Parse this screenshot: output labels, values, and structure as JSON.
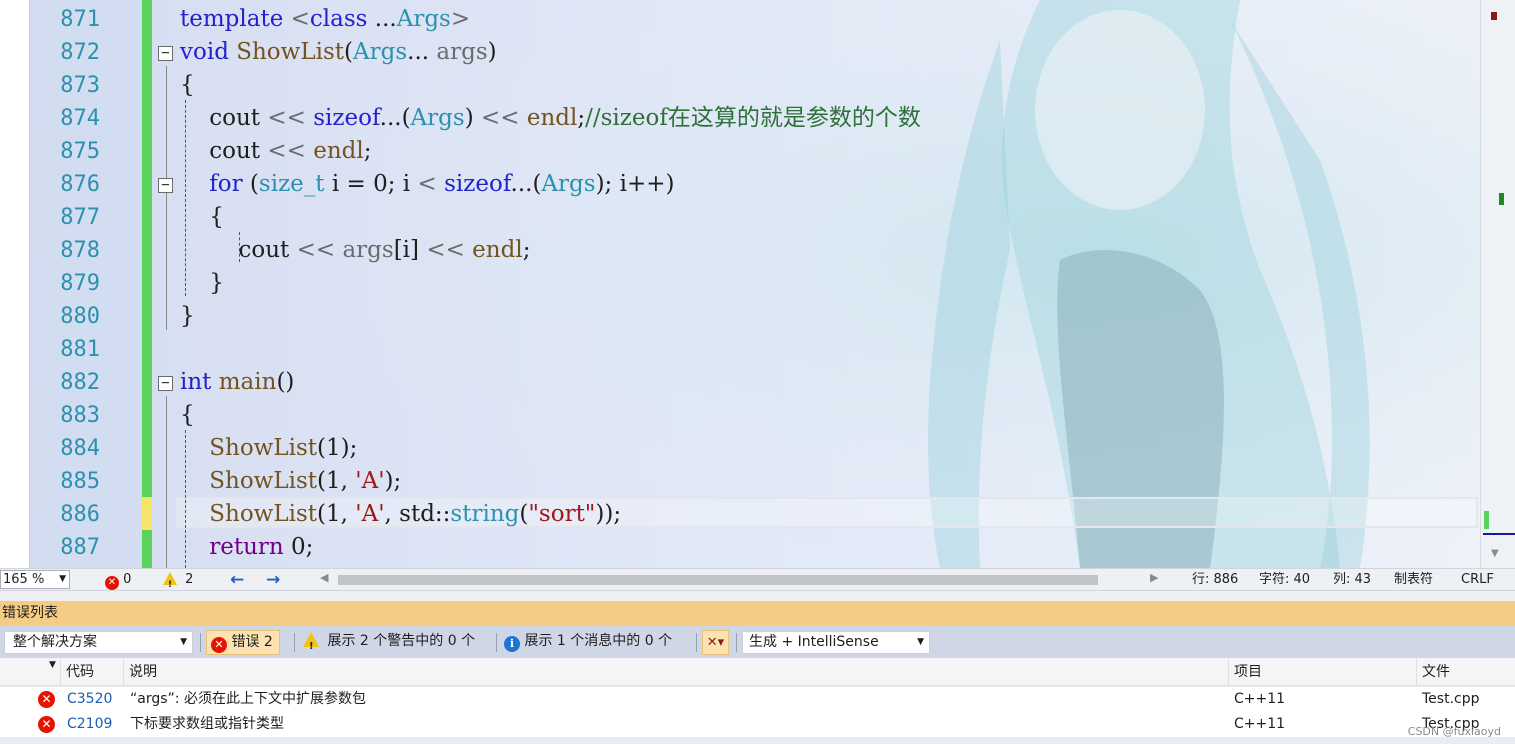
{
  "editor": {
    "lines": [
      {
        "num": "871",
        "fold": "",
        "tokens": [
          [
            "kw",
            "template "
          ],
          [
            "pm",
            "<"
          ],
          [
            "kw",
            "class "
          ],
          [
            "nm",
            "..."
          ],
          [
            "ty",
            "Args"
          ],
          [
            "pm",
            ">"
          ]
        ]
      },
      {
        "num": "872",
        "fold": "−",
        "tokens": [
          [
            "kw",
            "void "
          ],
          [
            "fn",
            "ShowList"
          ],
          [
            "nm",
            "("
          ],
          [
            "ty",
            "Args"
          ],
          [
            "nm",
            "... "
          ],
          [
            "pm",
            "args"
          ],
          [
            "nm",
            ")"
          ]
        ]
      },
      {
        "num": "873",
        "fold": "",
        "tokens": [
          [
            "nm",
            "{"
          ]
        ]
      },
      {
        "num": "874",
        "fold": "",
        "tokens": [
          [
            "nm",
            "    cout "
          ],
          [
            "pm",
            "<< "
          ],
          [
            "kw",
            "sizeof"
          ],
          [
            "nm",
            "...("
          ],
          [
            "ty",
            "Args"
          ],
          [
            "nm",
            ") "
          ],
          [
            "pm",
            "<< "
          ],
          [
            "fn",
            "endl"
          ],
          [
            "nm",
            ";"
          ],
          [
            "cm",
            "//sizeof在这算的就是参数的个数"
          ]
        ]
      },
      {
        "num": "875",
        "fold": "",
        "tokens": [
          [
            "nm",
            "    cout "
          ],
          [
            "pm",
            "<< "
          ],
          [
            "fn",
            "endl"
          ],
          [
            "nm",
            ";"
          ]
        ]
      },
      {
        "num": "876",
        "fold": "−",
        "tokens": [
          [
            "nm",
            "    "
          ],
          [
            "kw",
            "for "
          ],
          [
            "nm",
            "("
          ],
          [
            "ty",
            "size_t "
          ],
          [
            "nm",
            "i = 0; i "
          ],
          [
            "pm",
            "< "
          ],
          [
            "kw",
            "sizeof"
          ],
          [
            "nm",
            "...("
          ],
          [
            "ty",
            "Args"
          ],
          [
            "nm",
            "); i++)"
          ]
        ]
      },
      {
        "num": "877",
        "fold": "",
        "tokens": [
          [
            "nm",
            "    {"
          ]
        ]
      },
      {
        "num": "878",
        "fold": "",
        "tokens": [
          [
            "nm",
            "        cout "
          ],
          [
            "pm",
            "<< "
          ],
          [
            "pm",
            "args"
          ],
          [
            "nm",
            "[i] "
          ],
          [
            "pm",
            "<< "
          ],
          [
            "fn",
            "endl"
          ],
          [
            "nm",
            ";"
          ]
        ]
      },
      {
        "num": "879",
        "fold": "",
        "tokens": [
          [
            "nm",
            "    }"
          ]
        ]
      },
      {
        "num": "880",
        "fold": "",
        "tokens": [
          [
            "nm",
            "}"
          ]
        ]
      },
      {
        "num": "881",
        "fold": "",
        "tokens": []
      },
      {
        "num": "882",
        "fold": "−",
        "tokens": [
          [
            "kw",
            "int "
          ],
          [
            "fn",
            "main"
          ],
          [
            "nm",
            "()"
          ]
        ]
      },
      {
        "num": "883",
        "fold": "",
        "tokens": [
          [
            "nm",
            "{"
          ]
        ]
      },
      {
        "num": "884",
        "fold": "",
        "tokens": [
          [
            "nm",
            "    "
          ],
          [
            "fn",
            "ShowList"
          ],
          [
            "nm",
            "(1);"
          ]
        ]
      },
      {
        "num": "885",
        "fold": "",
        "tokens": [
          [
            "nm",
            "    "
          ],
          [
            "fn",
            "ShowList"
          ],
          [
            "nm",
            "(1, "
          ],
          [
            "st",
            "'A'"
          ],
          [
            "nm",
            ");"
          ]
        ]
      },
      {
        "num": "886",
        "fold": "",
        "tokens": [
          [
            "nm",
            "    "
          ],
          [
            "fn",
            "ShowList"
          ],
          [
            "nm",
            "(1, "
          ],
          [
            "st",
            "'A'"
          ],
          [
            "nm",
            ", std::"
          ],
          [
            "ty",
            "string"
          ],
          [
            "nm",
            "("
          ],
          [
            "st",
            "\"sort\""
          ],
          [
            "nm",
            "));"
          ]
        ]
      },
      {
        "num": "887",
        "fold": "",
        "tokens": [
          [
            "nm",
            "    "
          ],
          [
            "mc",
            "return "
          ],
          [
            "nm",
            "0;"
          ]
        ]
      }
    ]
  },
  "status": {
    "zoom": "165 %",
    "errors": "0",
    "warnings": "2",
    "row": "行: 886",
    "char": "字符: 40",
    "col": "列: 43",
    "tab": "制表符",
    "eol": "CRLF"
  },
  "error_list": {
    "title": "错误列表",
    "scope": "整个解决方案",
    "errors_btn": "错误 2",
    "warnings_btn": "展示 2 个警告中的 0 个",
    "messages_btn": "展示 1 个消息中的 0 个",
    "build_filter": "生成 + IntelliSense",
    "columns": {
      "code": "代码",
      "desc": "说明",
      "project": "项目",
      "file": "文件"
    },
    "rows": [
      {
        "code": "C3520",
        "desc": "“args”: 必须在此上下文中扩展参数包",
        "project": "C++11",
        "file": "Test.cpp"
      },
      {
        "code": "C2109",
        "desc": "下标要求数组或指针类型",
        "project": "C++11",
        "file": "Test.cpp"
      }
    ],
    "watermark": "CSDN @fuxiaoyd"
  },
  "colors": {
    "error": "#e51400",
    "warning": "#f2c40e",
    "title_bar": "#f5cc84",
    "change_bar": "#5ad35a"
  }
}
